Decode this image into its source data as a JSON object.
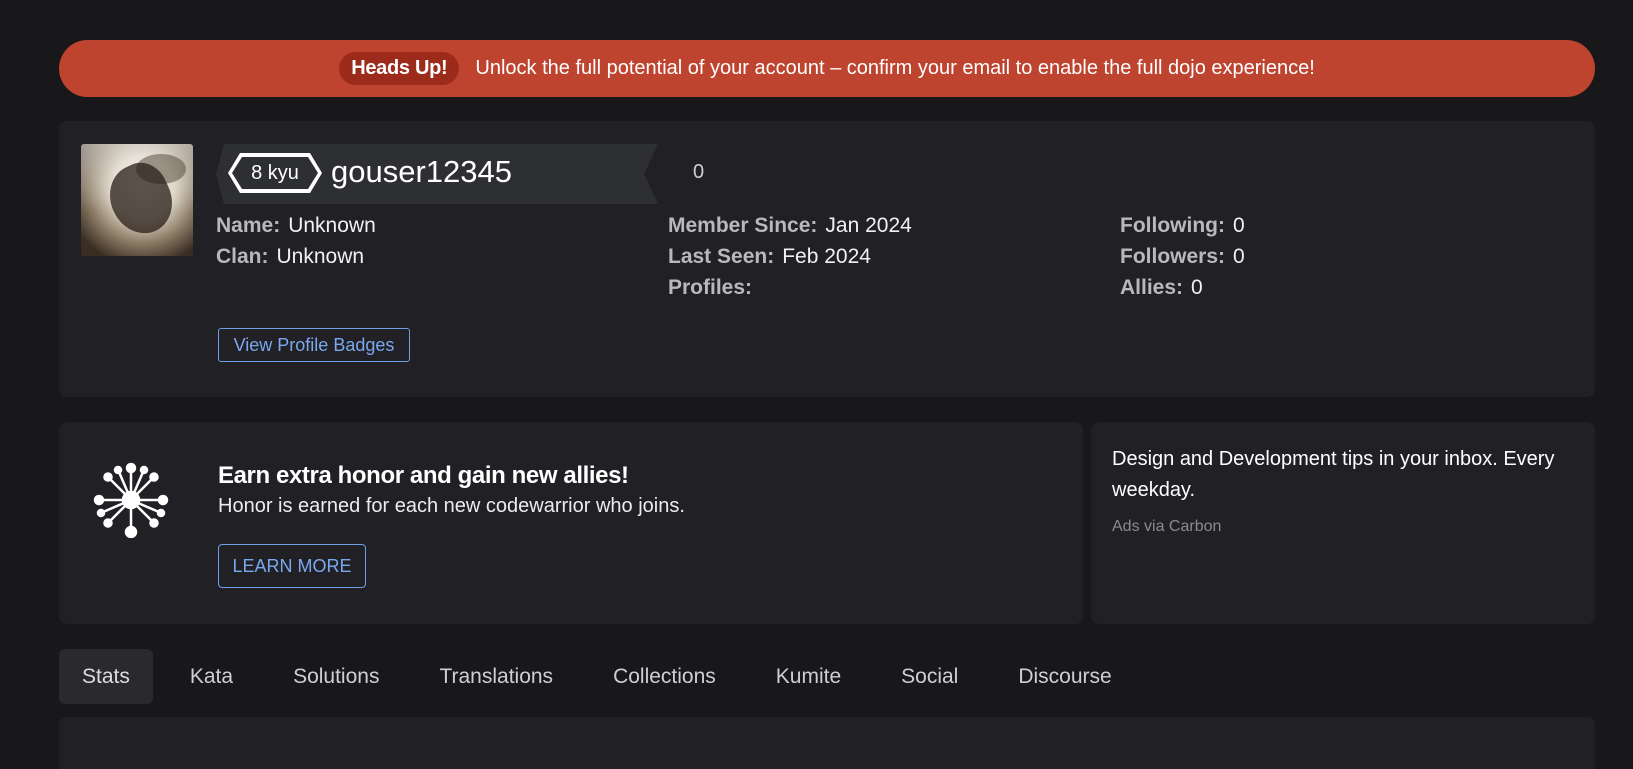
{
  "alert": {
    "pill": "Heads Up!",
    "message": "Unlock the full potential of your account – confirm your email to enable the full dojo experience!"
  },
  "profile": {
    "rank": "8 kyu",
    "username": "gouser12345",
    "honor": "0",
    "fields": {
      "name_label": "Name:",
      "name_value": "Unknown",
      "clan_label": "Clan:",
      "clan_value": "Unknown",
      "member_since_label": "Member Since:",
      "member_since_value": "Jan 2024",
      "last_seen_label": "Last Seen:",
      "last_seen_value": "Feb 2024",
      "profiles_label": "Profiles:",
      "following_label": "Following:",
      "following_value": "0",
      "followers_label": "Followers:",
      "followers_value": "0",
      "allies_label": "Allies:",
      "allies_value": "0"
    },
    "badges_button": "View Profile Badges"
  },
  "promo": {
    "title": "Earn extra honor and gain new allies!",
    "subtitle": "Honor is earned for each new codewarrior who joins.",
    "button": "LEARN MORE"
  },
  "ad": {
    "text": "Design and Development tips in your inbox. Every weekday.",
    "via": "Ads via Carbon"
  },
  "tabs": [
    {
      "label": "Stats",
      "active": true
    },
    {
      "label": "Kata",
      "active": false
    },
    {
      "label": "Solutions",
      "active": false
    },
    {
      "label": "Translations",
      "active": false
    },
    {
      "label": "Collections",
      "active": false
    },
    {
      "label": "Kumite",
      "active": false
    },
    {
      "label": "Social",
      "active": false
    },
    {
      "label": "Discourse",
      "active": false
    }
  ],
  "colors": {
    "alert": "#bf4430",
    "accent": "#7aa7ee",
    "panel": "#212125",
    "background": "#18181b"
  }
}
